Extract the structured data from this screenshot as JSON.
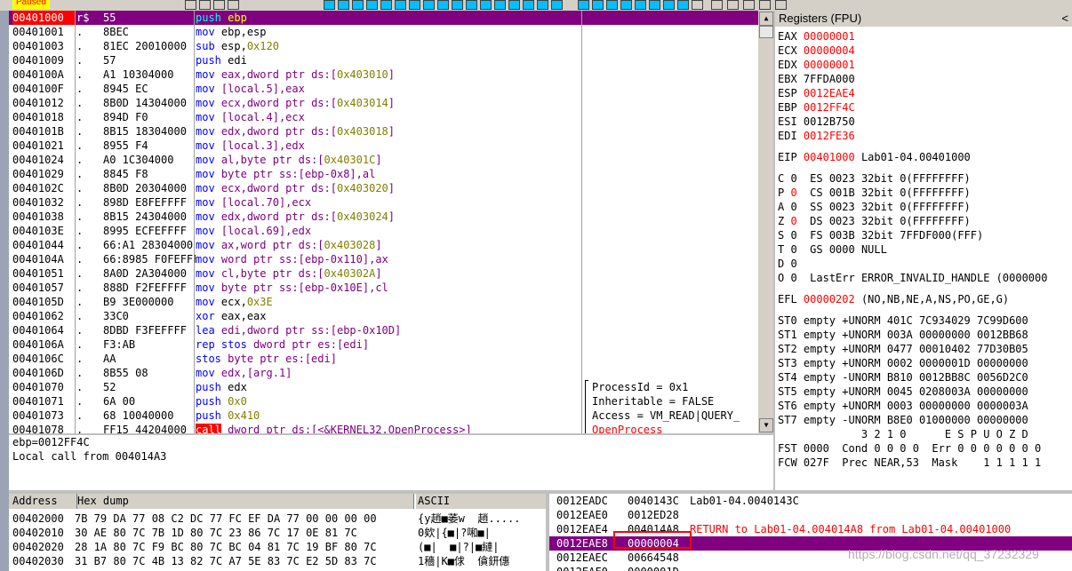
{
  "toolbar": {
    "status": "Paused"
  },
  "disasm": {
    "rows": [
      {
        "addr": "00401000",
        "mark": "r$",
        "hex": "55",
        "mn": "push",
        "ops": [
          [
            "ebp",
            "r"
          ]
        ]
      },
      {
        "addr": "00401001",
        "mark": ".",
        "hex": "8BEC",
        "mn": "mov",
        "ops": [
          [
            "ebp,esp",
            "r"
          ]
        ]
      },
      {
        "addr": "00401003",
        "mark": ".",
        "hex": "81EC 20010000",
        "mn": "sub",
        "ops": [
          [
            "esp,",
            "r"
          ],
          [
            "0x120",
            "n"
          ]
        ]
      },
      {
        "addr": "00401009",
        "mark": ".",
        "hex": "57",
        "mn": "push",
        "ops": [
          [
            "edi",
            "r"
          ]
        ]
      },
      {
        "addr": "0040100A",
        "mark": ".",
        "hex": "A1 10304000",
        "mn": "mov",
        "ops": [
          [
            "eax,dword ptr ds:[",
            "p"
          ],
          [
            "0x403010",
            "n"
          ],
          [
            "]",
            "p"
          ]
        ]
      },
      {
        "addr": "0040100F",
        "mark": ".",
        "hex": "8945 EC",
        "mn": "mov",
        "ops": [
          [
            "[local.5],eax",
            "p"
          ]
        ]
      },
      {
        "addr": "00401012",
        "mark": ".",
        "hex": "8B0D 14304000",
        "mn": "mov",
        "ops": [
          [
            "ecx,dword ptr ds:[",
            "p"
          ],
          [
            "0x403014",
            "n"
          ],
          [
            "]",
            "p"
          ]
        ]
      },
      {
        "addr": "00401018",
        "mark": ".",
        "hex": "894D F0",
        "mn": "mov",
        "ops": [
          [
            "[local.4],ecx",
            "p"
          ]
        ]
      },
      {
        "addr": "0040101B",
        "mark": ".",
        "hex": "8B15 18304000",
        "mn": "mov",
        "ops": [
          [
            "edx,dword ptr ds:[",
            "p"
          ],
          [
            "0x403018",
            "n"
          ],
          [
            "]",
            "p"
          ]
        ]
      },
      {
        "addr": "00401021",
        "mark": ".",
        "hex": "8955 F4",
        "mn": "mov",
        "ops": [
          [
            "[local.3],edx",
            "p"
          ]
        ]
      },
      {
        "addr": "00401024",
        "mark": ".",
        "hex": "A0 1C304000",
        "mn": "mov",
        "ops": [
          [
            "al,byte ptr ds:[",
            "p"
          ],
          [
            "0x40301C",
            "n"
          ],
          [
            "]",
            "p"
          ]
        ]
      },
      {
        "addr": "00401029",
        "mark": ".",
        "hex": "8845 F8",
        "mn": "mov",
        "ops": [
          [
            "byte ptr ss:[ebp-0x8],al",
            "p"
          ]
        ]
      },
      {
        "addr": "0040102C",
        "mark": ".",
        "hex": "8B0D 20304000",
        "mn": "mov",
        "ops": [
          [
            "ecx,dword ptr ds:[",
            "p"
          ],
          [
            "0x403020",
            "n"
          ],
          [
            "]",
            "p"
          ]
        ]
      },
      {
        "addr": "00401032",
        "mark": ".",
        "hex": "898D E8FEFFFF",
        "mn": "mov",
        "ops": [
          [
            "[local.70],ecx",
            "p"
          ]
        ]
      },
      {
        "addr": "00401038",
        "mark": ".",
        "hex": "8B15 24304000",
        "mn": "mov",
        "ops": [
          [
            "edx,dword ptr ds:[",
            "p"
          ],
          [
            "0x403024",
            "n"
          ],
          [
            "]",
            "p"
          ]
        ]
      },
      {
        "addr": "0040103E",
        "mark": ".",
        "hex": "8995 ECFEFFFF",
        "mn": "mov",
        "ops": [
          [
            "[local.69],edx",
            "p"
          ]
        ]
      },
      {
        "addr": "00401044",
        "mark": ".",
        "hex": "66:A1 28304000",
        "mn": "mov",
        "ops": [
          [
            "ax,word ptr ds:[",
            "p"
          ],
          [
            "0x403028",
            "n"
          ],
          [
            "]",
            "p"
          ]
        ]
      },
      {
        "addr": "0040104A",
        "mark": ".",
        "hex": "66:8985 F0FEFFFF",
        "mn": "mov",
        "ops": [
          [
            "word ptr ss:[ebp-0x110],ax",
            "p"
          ]
        ]
      },
      {
        "addr": "00401051",
        "mark": ".",
        "hex": "8A0D 2A304000",
        "mn": "mov",
        "ops": [
          [
            "cl,byte ptr ds:[",
            "p"
          ],
          [
            "0x40302A",
            "n"
          ],
          [
            "]",
            "p"
          ]
        ]
      },
      {
        "addr": "00401057",
        "mark": ".",
        "hex": "888D F2FEFFFF",
        "mn": "mov",
        "ops": [
          [
            "byte ptr ss:[ebp-0x10E],cl",
            "p"
          ]
        ]
      },
      {
        "addr": "0040105D",
        "mark": ".",
        "hex": "B9 3E000000",
        "mn": "mov",
        "ops": [
          [
            "ecx,",
            "r"
          ],
          [
            "0x3E",
            "n"
          ]
        ]
      },
      {
        "addr": "00401062",
        "mark": ".",
        "hex": "33C0",
        "mn": "xor",
        "ops": [
          [
            "eax,eax",
            "r"
          ]
        ]
      },
      {
        "addr": "00401064",
        "mark": ".",
        "hex": "8DBD F3FEFFFF",
        "mn": "lea",
        "ops": [
          [
            "edi,dword ptr ss:[ebp-0x10D]",
            "p"
          ]
        ]
      },
      {
        "addr": "0040106A",
        "mark": ".",
        "hex": "F3:AB",
        "mn": "rep stos",
        "ops": [
          [
            "dword ptr es:[edi]",
            "p"
          ]
        ]
      },
      {
        "addr": "0040106C",
        "mark": ".",
        "hex": "AA",
        "mn": "stos",
        "ops": [
          [
            "byte ptr es:[edi]",
            "p"
          ]
        ]
      },
      {
        "addr": "0040106D",
        "mark": ".",
        "hex": "8B55 08",
        "mn": "mov",
        "ops": [
          [
            "edx,[arg.1]",
            "p"
          ]
        ]
      },
      {
        "addr": "00401070",
        "mark": ".",
        "hex": "52",
        "mn": "push",
        "ops": [
          [
            "edx",
            "r"
          ]
        ]
      },
      {
        "addr": "00401071",
        "mark": ".",
        "hex": "6A 00",
        "mn": "push",
        "ops": [
          [
            "0x0",
            "n"
          ]
        ]
      },
      {
        "addr": "00401073",
        "mark": ".",
        "hex": "68 10040000",
        "mn": "push",
        "ops": [
          [
            "0x410",
            "n"
          ]
        ]
      },
      {
        "addr": "00401078",
        "mark": ".",
        "hex": "FF15 44204000",
        "mn": "call",
        "ops": [
          [
            "dword ptr ds:[<&KERNEL32.OpenProcess>]",
            "p"
          ]
        ]
      }
    ],
    "comments": [
      "ProcessId = 0x1",
      "Inheritable = FALSE",
      "Access = VM_READ|QUERY_",
      "OpenProcess"
    ]
  },
  "info": {
    "line1": "ebp=0012FF4C",
    "line2": "Local call from 004014A3"
  },
  "registers": {
    "title": "Registers (FPU)",
    "close": "<",
    "gp": [
      {
        "name": "EAX",
        "value": "00000001",
        "changed": true,
        "comment": ""
      },
      {
        "name": "ECX",
        "value": "00000004",
        "changed": true,
        "comment": ""
      },
      {
        "name": "EDX",
        "value": "00000001",
        "changed": true,
        "comment": ""
      },
      {
        "name": "EBX",
        "value": "7FFDA000",
        "changed": false,
        "comment": ""
      },
      {
        "name": "ESP",
        "value": "0012EAE4",
        "changed": true,
        "comment": ""
      },
      {
        "name": "EBP",
        "value": "0012FF4C",
        "changed": true,
        "comment": ""
      },
      {
        "name": "ESI",
        "value": "0012B750",
        "changed": false,
        "comment": ""
      },
      {
        "name": "EDI",
        "value": "0012FE36",
        "changed": true,
        "comment": ""
      }
    ],
    "eip": {
      "name": "EIP",
      "value": "00401000",
      "comment": "Lab01-04.00401000"
    },
    "flags": [
      {
        "f": "C",
        "v": "0",
        "changed": false,
        "rest": "ES 0023 32bit 0(FFFFFFFF)"
      },
      {
        "f": "P",
        "v": "0",
        "changed": true,
        "rest": "CS 001B 32bit 0(FFFFFFFF)"
      },
      {
        "f": "A",
        "v": "0",
        "changed": false,
        "rest": "SS 0023 32bit 0(FFFFFFFF)"
      },
      {
        "f": "Z",
        "v": "0",
        "changed": true,
        "rest": "DS 0023 32bit 0(FFFFFFFF)"
      },
      {
        "f": "S",
        "v": "0",
        "changed": false,
        "rest": "FS 003B 32bit 7FFDF000(FFF)"
      },
      {
        "f": "T",
        "v": "0",
        "changed": false,
        "rest": "GS 0000 NULL"
      },
      {
        "f": "D",
        "v": "0",
        "changed": false,
        "rest": ""
      },
      {
        "f": "O",
        "v": "0",
        "changed": false,
        "rest": "LastErr ERROR_INVALID_HANDLE (0000000"
      }
    ],
    "efl": {
      "name": "EFL",
      "value": "00000202",
      "comment": "(NO,NB,NE,A,NS,PO,GE,G)"
    },
    "st": [
      "ST0 empty +UNORM 401C 7C934029 7C99D600",
      "ST1 empty +UNORM 003A 00000000 0012BB68",
      "ST2 empty +UNORM 0477 00010402 77D30B05",
      "ST3 empty +UNORM 0002 0000001D 00000000",
      "ST4 empty -UNORM B810 0012BB8C 0056D2C0",
      "ST5 empty +UNORM 0045 0208003A 00000000",
      "ST6 empty +UNORM 0003 00000000 0000003A",
      "ST7 empty -UNORM B8E0 01000000 00000000"
    ],
    "fpu_hdr": "             3 2 1 0      E S P U O Z D",
    "fst": "FST 0000  Cond 0 0 0 0  Err 0 0 0 0 0 0 0",
    "fcw": "FCW 027F  Prec NEAR,53  Mask    1 1 1 1 1"
  },
  "dump": {
    "headers": {
      "address": "Address",
      "hex": "Hex dump",
      "ascii": "ASCII"
    },
    "rows": [
      {
        "a": "00402000",
        "h": "7B 79 DA 77 08 C2 DC 77 FC EF DA 77 00 00 00 00",
        "s": "{y趙■萎w  趙....."
      },
      {
        "a": "00402010",
        "h": "30 AE 80 7C 7B 1D 80 7C 23 86 7C 17 0E 81 7C",
        "s": "0欸|{■|?啝■|"
      },
      {
        "a": "00402020",
        "h": "28 1A 80 7C F9 BC 80 7C BC 04 81 7C 19 BF 80 7C",
        "s": "(■|  ■|?|■縺|"
      },
      {
        "a": "00402030",
        "h": "31 B7 80 7C 4B 13 82 7C A7 5E 83 7C E2 5D 83 7C",
        "s": "1穡|K■俅  僋鈃僡"
      }
    ]
  },
  "stack": {
    "rows": [
      {
        "a": "0012EADC",
        "v": "0040143C",
        "c": "Lab01-04.0040143C",
        "sel": false,
        "ret": false
      },
      {
        "a": "0012EAE0",
        "v": "0012ED28",
        "c": "",
        "sel": false,
        "ret": false
      },
      {
        "a": "0012EAE4",
        "v": "004014A8",
        "c": "RETURN to Lab01-04.004014A8 from Lab01-04.00401000",
        "sel": false,
        "ret": true
      },
      {
        "a": "0012EAE8",
        "v": "00000004",
        "c": "",
        "sel": true,
        "ret": false
      },
      {
        "a": "0012EAEC",
        "v": "00664548",
        "c": "",
        "sel": false,
        "ret": false
      },
      {
        "a": "0012EAF0",
        "v": "0000001D",
        "c": "",
        "sel": false,
        "ret": false
      }
    ]
  },
  "watermark": "https://blog.csdn.net/qq_37232329",
  "colors": {
    "mnemonic": "#0000ff",
    "number": "#808000",
    "operand": "#800080",
    "selected_row": "#800080",
    "changed": "#ff0000",
    "eip_bg": "#ff0000"
  }
}
